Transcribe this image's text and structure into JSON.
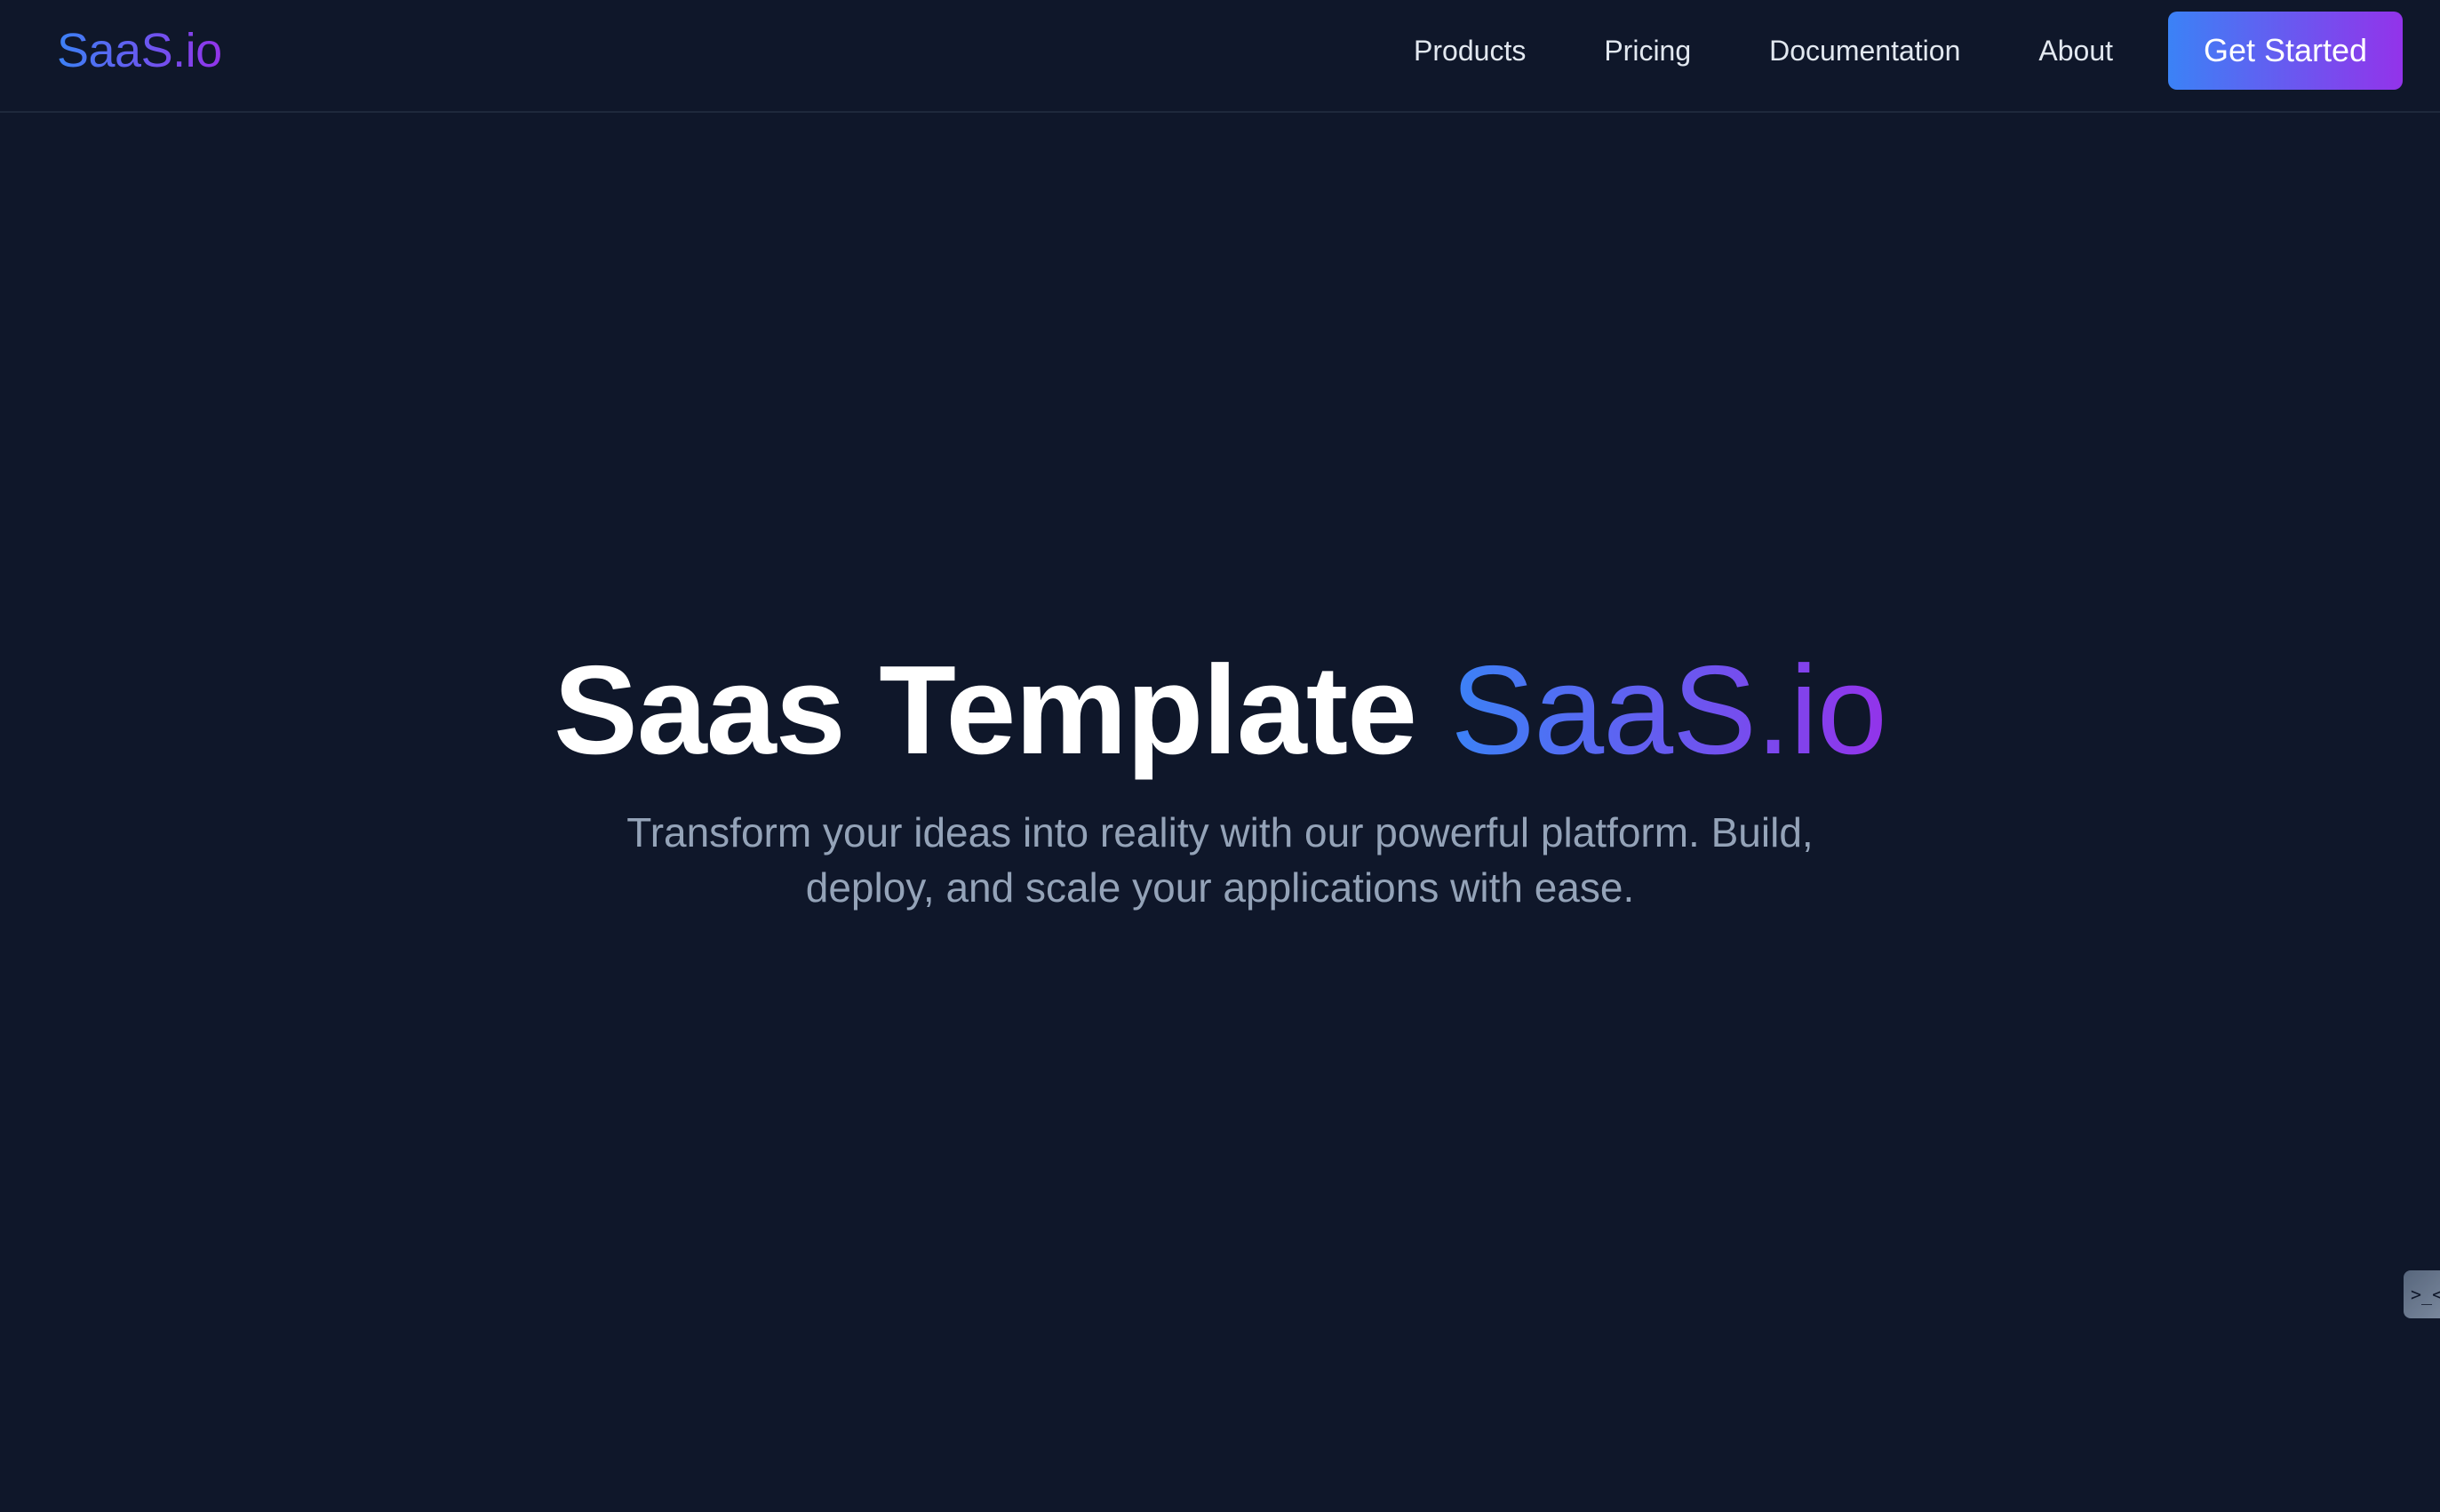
{
  "navbar": {
    "logo": "SaaS.io",
    "links": [
      {
        "label": "Products"
      },
      {
        "label": "Pricing"
      },
      {
        "label": "Documentation"
      },
      {
        "label": "About"
      }
    ],
    "cta_label": "Get Started"
  },
  "hero": {
    "title_main": "Saas Template ",
    "title_accent": "SaaS.io",
    "subtitle": "Transform your ideas into reality with our powerful platform. Build, deploy, and scale your applications with ease."
  },
  "devtools": {
    "icon": "terminal-icon",
    "glyph": ">_<"
  },
  "colors": {
    "background": "#0f172a",
    "gradient_start": "#3b82f6",
    "gradient_end": "#9333ea",
    "subtitle": "#94a3b8",
    "nav_text": "#e2e8f0"
  }
}
